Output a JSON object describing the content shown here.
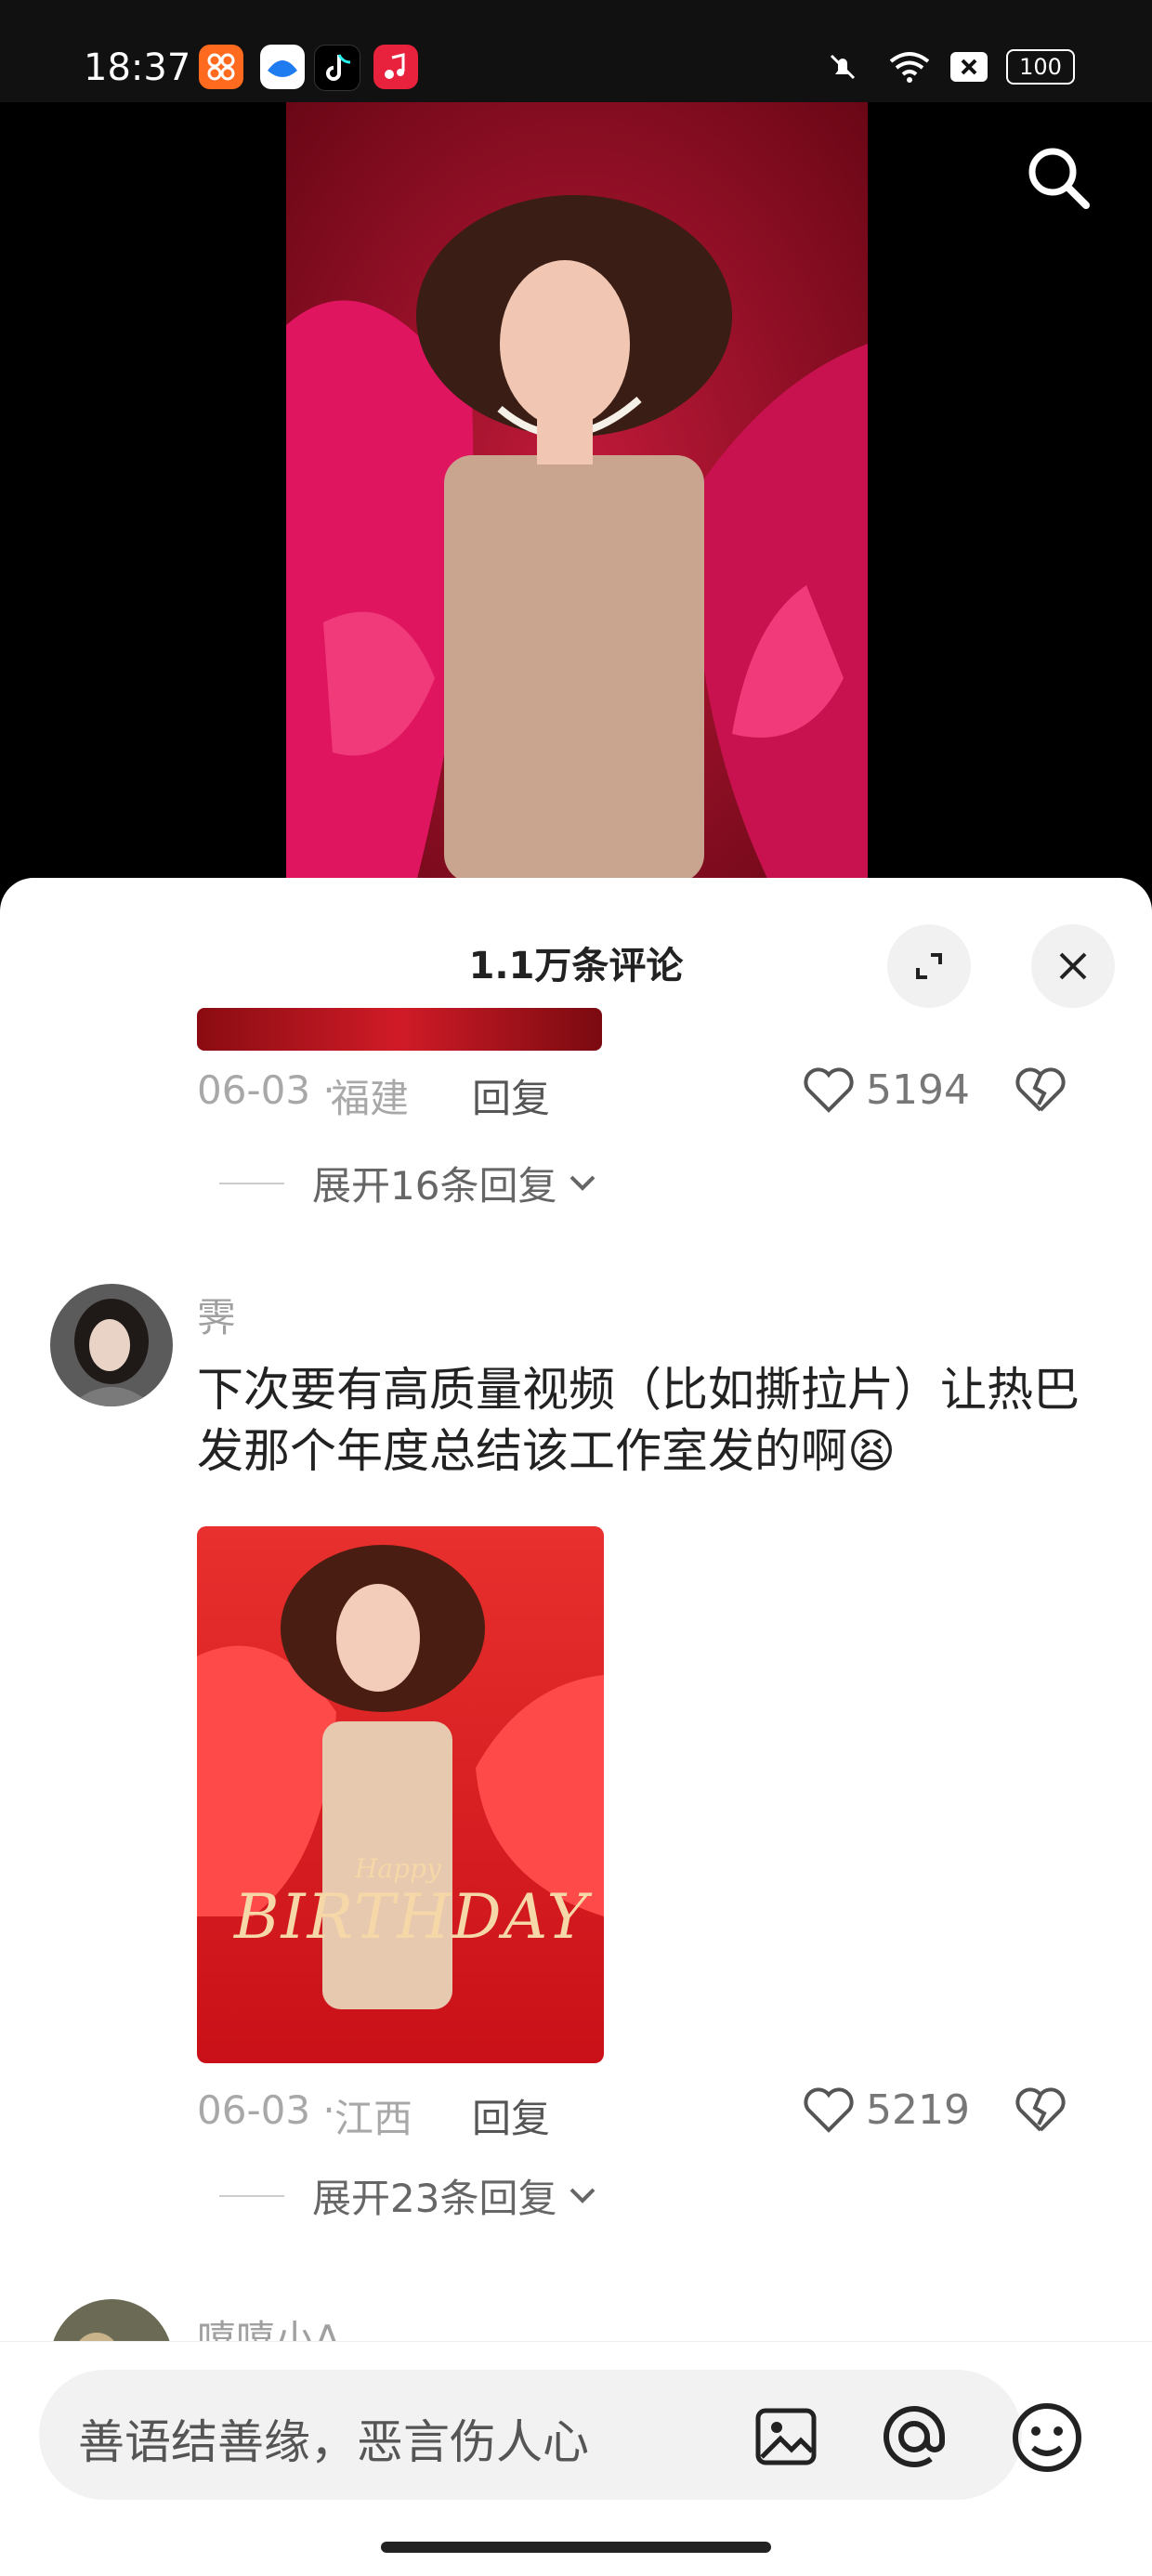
{
  "status_bar": {
    "time": "18:37",
    "battery": "100",
    "icons": [
      "app-orange-icon",
      "app-blue-icon",
      "tiktok-icon",
      "music-icon",
      "mute-icon",
      "wifi-icon",
      "sim-x-icon",
      "battery-icon"
    ]
  },
  "sheet": {
    "title": "1.1万条评论"
  },
  "comment1": {
    "date": "06-03 ·",
    "location": "福建",
    "reply_label": "回复",
    "likes": "5194",
    "expand_label": "展开16条回复"
  },
  "comment2": {
    "username": "霁",
    "text": "下次要有高质量视频（比如撕拉片）让热巴发那个年度总结该工作室发的啊😫",
    "image_lines": {
      "big": "BIRTHDAY",
      "small": "Happy"
    },
    "date": "06-03 ·",
    "location": "江西",
    "reply_label": "回复",
    "likes": "5219",
    "expand_label": "展开23条回复"
  },
  "comment3": {
    "username": "嘻嘻小A"
  },
  "input_bar": {
    "placeholder": "善语结善缘，恶言伤人心"
  },
  "colors": {
    "accent_red": "#d41c3c",
    "sheet_bg": "#ffffff",
    "muted_text": "#a8a8a8"
  }
}
